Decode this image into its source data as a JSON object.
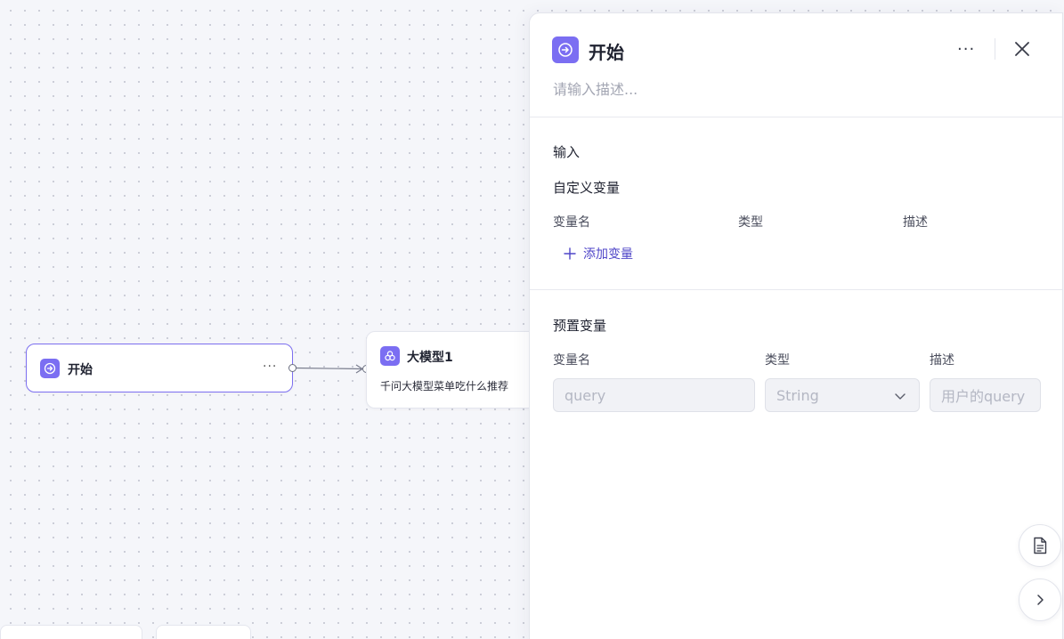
{
  "canvas": {
    "start_node": {
      "title": "开始",
      "more": "···",
      "icon": "start-arrow-icon"
    },
    "llm_node": {
      "title": "大模型1",
      "description": "千问大模型菜单吃什么推荐",
      "icon": "llm-model-icon"
    }
  },
  "panel": {
    "title": "开始",
    "description_placeholder": "请输入描述...",
    "more": "···",
    "input_section": {
      "title": "输入",
      "custom_vars": {
        "title": "自定义变量",
        "columns": [
          "变量名",
          "类型",
          "描述"
        ],
        "add_label": "添加变量"
      }
    },
    "preset_section": {
      "title": "预置变量",
      "columns": [
        "变量名",
        "类型",
        "描述"
      ],
      "row": {
        "name": "query",
        "type": "String",
        "desc": "用户的query"
      }
    }
  },
  "colors": {
    "accent": "#7b6ef2",
    "link": "#4f46c8"
  }
}
